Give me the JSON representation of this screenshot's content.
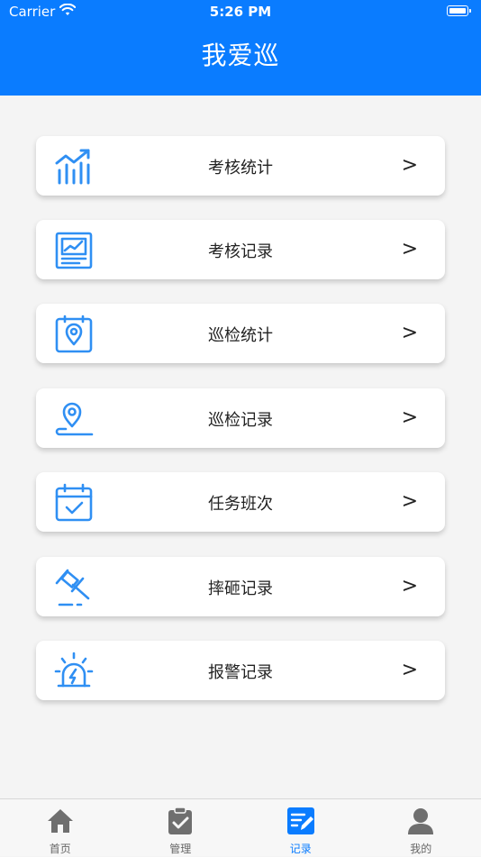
{
  "status_bar": {
    "carrier": "Carrier",
    "time": "5:26 PM"
  },
  "header": {
    "title": "我爱巡"
  },
  "colors": {
    "accent": "#0a7cff",
    "icon_blue": "#2f8ff3",
    "tab_gray": "#6f6f6f"
  },
  "menu": {
    "arrow": ">",
    "items": [
      {
        "label": "考核统计",
        "icon": "trend-chart-icon"
      },
      {
        "label": "考核记录",
        "icon": "report-chart-icon"
      },
      {
        "label": "巡检统计",
        "icon": "location-calendar-icon"
      },
      {
        "label": "巡检记录",
        "icon": "location-pin-icon"
      },
      {
        "label": "任务班次",
        "icon": "calendar-check-icon"
      },
      {
        "label": "摔砸记录",
        "icon": "gavel-icon"
      },
      {
        "label": "报警记录",
        "icon": "alarm-light-icon"
      }
    ]
  },
  "tabs": [
    {
      "label": "首页",
      "icon": "home-icon"
    },
    {
      "label": "管理",
      "icon": "clipboard-check-icon"
    },
    {
      "label": "记录",
      "icon": "edit-note-icon",
      "active": true
    },
    {
      "label": "我的",
      "icon": "user-icon"
    }
  ]
}
